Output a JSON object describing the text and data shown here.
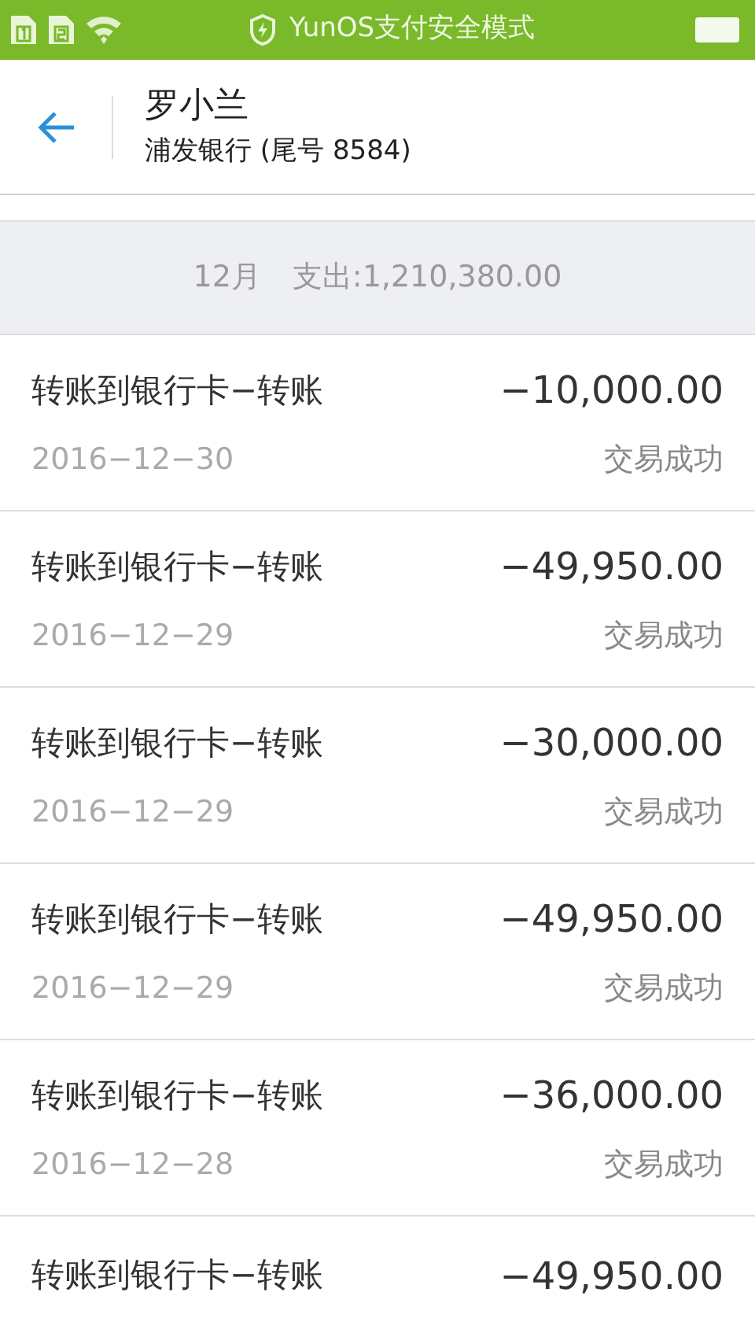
{
  "status_bar": {
    "title": "YunOS支付安全模式"
  },
  "header": {
    "name": "罗小兰",
    "account": "浦发银行 (尾号 8584)"
  },
  "summary": {
    "month": "12月",
    "expense": "支出:1,210,380.00"
  },
  "transactions": [
    {
      "title": "转账到银行卡−转账",
      "amount": "−10,000.00",
      "date": "2016−12−30",
      "status": "交易成功"
    },
    {
      "title": "转账到银行卡−转账",
      "amount": "−49,950.00",
      "date": "2016−12−29",
      "status": "交易成功"
    },
    {
      "title": "转账到银行卡−转账",
      "amount": "−30,000.00",
      "date": "2016−12−29",
      "status": "交易成功"
    },
    {
      "title": "转账到银行卡−转账",
      "amount": "−49,950.00",
      "date": "2016−12−29",
      "status": "交易成功"
    },
    {
      "title": "转账到银行卡−转账",
      "amount": "−36,000.00",
      "date": "2016−12−28",
      "status": "交易成功"
    },
    {
      "title": "转账到银行卡−转账",
      "amount": "−49,950.00"
    }
  ]
}
